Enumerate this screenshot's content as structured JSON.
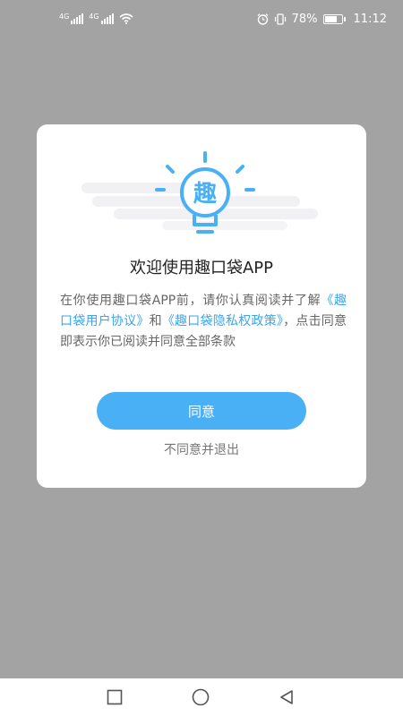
{
  "status_bar": {
    "signal_1_label": "4G",
    "signal_2_label": "4G",
    "battery_percent": "78%",
    "battery_level": 0.78,
    "time": "11:12",
    "icons": [
      "signal-icon",
      "wifi-icon",
      "alarm-icon",
      "vibrate-icon",
      "battery-icon"
    ]
  },
  "dialog": {
    "logo_char": "趣",
    "title": "欢迎使用趣口袋APP",
    "body_prefix": "在你使用趣口袋APP前，请你认真阅读并了解",
    "user_agreement_link": "《趣口袋用户协议》",
    "connector": "和",
    "privacy_policy_link": "《趣口袋隐私权政策》",
    "body_suffix": "，点击同意即表示你已阅读并同意全部条款",
    "agree_label": "同意",
    "exit_label": "不同意并退出"
  },
  "colors": {
    "accent": "#49b0f5",
    "link": "#3aa6f2",
    "overlay": "#a3a3a3"
  },
  "nav_bar": {
    "icons": [
      "recent-apps-icon",
      "home-icon",
      "back-icon"
    ]
  }
}
